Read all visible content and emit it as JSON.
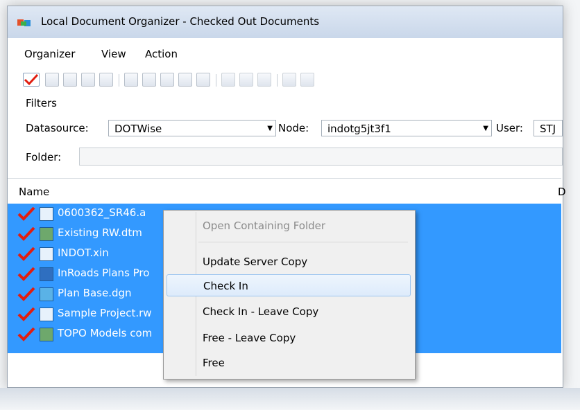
{
  "window": {
    "title": "Local Document Organizer - Checked Out Documents"
  },
  "menu": [
    "Organizer",
    "View",
    "Action"
  ],
  "filters": {
    "section_label": "Filters",
    "datasource_label": "Datasource:",
    "datasource_value": "DOTWise",
    "node_label": "Node:",
    "node_value": "indotg5jt3f1",
    "user_label": "User:",
    "user_value": "STJ",
    "folder_label": "Folder:"
  },
  "list": {
    "columns": [
      "Name",
      "D"
    ],
    "rows": [
      {
        "name": "0600362_SR46.a",
        "icon": "cogo-file-icon"
      },
      {
        "name": "Existing RW.dtm",
        "icon": "terrain-file-icon"
      },
      {
        "name": "INDOT.xin",
        "icon": "xin-file-icon"
      },
      {
        "name": "InRoads Plans Pro",
        "icon": "word-file-icon"
      },
      {
        "name": "Plan Base.dgn",
        "icon": "dgn-file-icon"
      },
      {
        "name": "Sample Project.rw",
        "icon": "project-file-icon"
      },
      {
        "name": "TOPO Models com",
        "icon": "terrain-file-icon"
      }
    ]
  },
  "context_menu": {
    "items": [
      {
        "label": "Open Containing Folder",
        "disabled": true
      },
      {
        "label": "Update Server Copy"
      },
      {
        "label": "Check In",
        "highlighted": true
      },
      {
        "label": "Check In - Leave Copy"
      },
      {
        "label": "Free - Leave Copy"
      },
      {
        "label": "Free"
      }
    ]
  },
  "colors": {
    "selection": "#3399ff",
    "check": "#e11d0f"
  }
}
